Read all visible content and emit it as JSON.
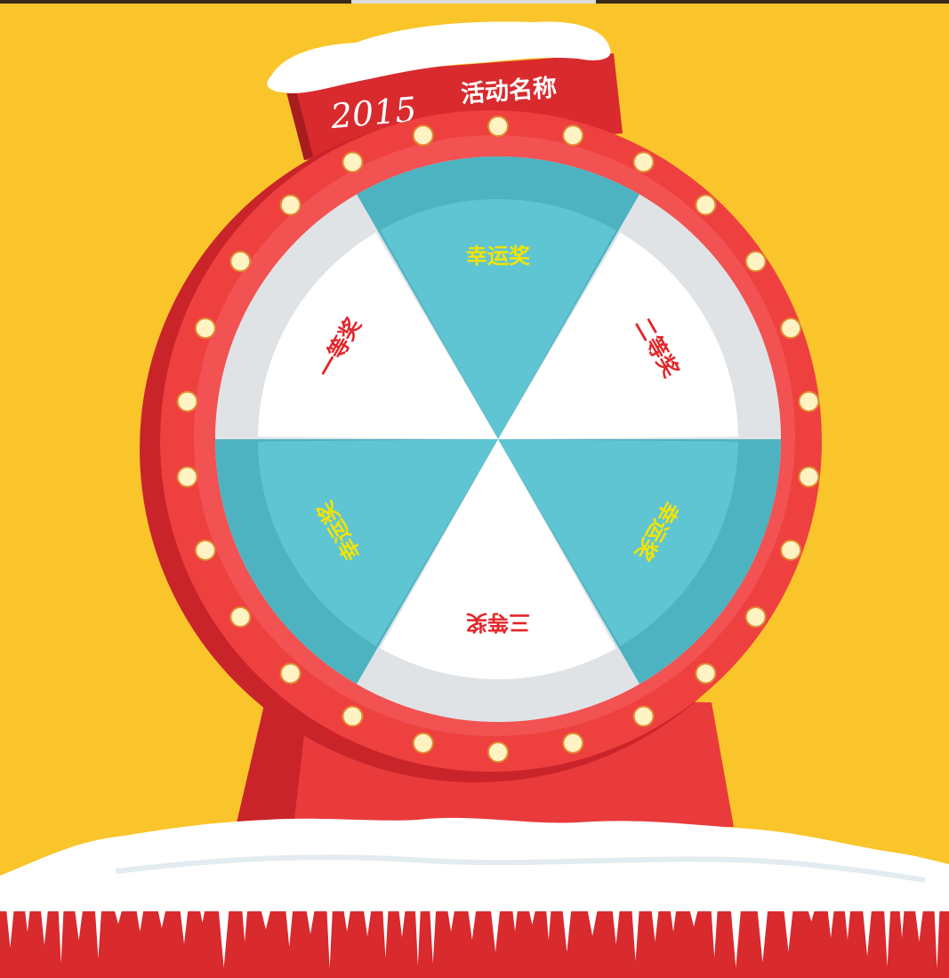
{
  "banner": {
    "year_text": "2015",
    "activity_name": "活动名称"
  },
  "wheel": {
    "segments": [
      {
        "label": "幸运奖",
        "fill": "#5fc5d3",
        "text_color": "#f2e400"
      },
      {
        "label": "二等奖",
        "fill": "#ffffff",
        "text_color": "#e3262b"
      },
      {
        "label": "幸运奖",
        "fill": "#5fc5d3",
        "text_color": "#f2e400"
      },
      {
        "label": "三等奖",
        "fill": "#ffffff",
        "text_color": "#e3262b"
      },
      {
        "label": "幸运奖",
        "fill": "#5fc5d3",
        "text_color": "#f2e400"
      },
      {
        "label": "一等奖",
        "fill": "#ffffff",
        "text_color": "#e3262b"
      }
    ],
    "bulb_count": 26
  },
  "colors": {
    "background": "#f9c52a",
    "rim": "#ef4040",
    "rim_dark": "#c9242a",
    "bulb": "#fff3c4",
    "snow": "#ffffff"
  }
}
